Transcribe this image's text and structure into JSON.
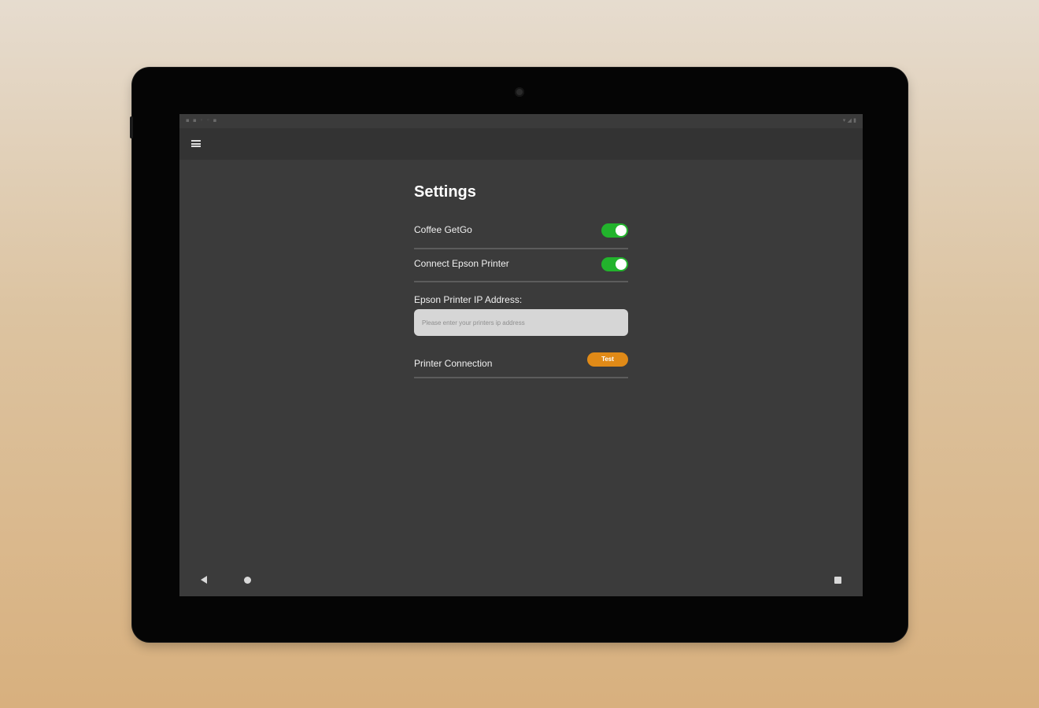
{
  "settings": {
    "title": "Settings",
    "coffee_getgo": {
      "label": "Coffee GetGo",
      "enabled": true
    },
    "connect_epson": {
      "label": "Connect Epson Printer",
      "enabled": true
    },
    "ip_address": {
      "label": "Epson Printer IP Address:",
      "value": "",
      "placeholder": "Please enter your printers ip address"
    },
    "printer_connection": {
      "label": "Printer Connection",
      "test_label": "Test"
    }
  },
  "colors": {
    "toggle_on": "#22b32c",
    "accent_orange": "#e08a17",
    "screen_bg": "#3b3b3b",
    "appbar_bg": "#333333"
  },
  "icons": {
    "menu": "menu-icon",
    "back": "back-icon",
    "home": "home-icon",
    "recents": "recents-icon"
  }
}
